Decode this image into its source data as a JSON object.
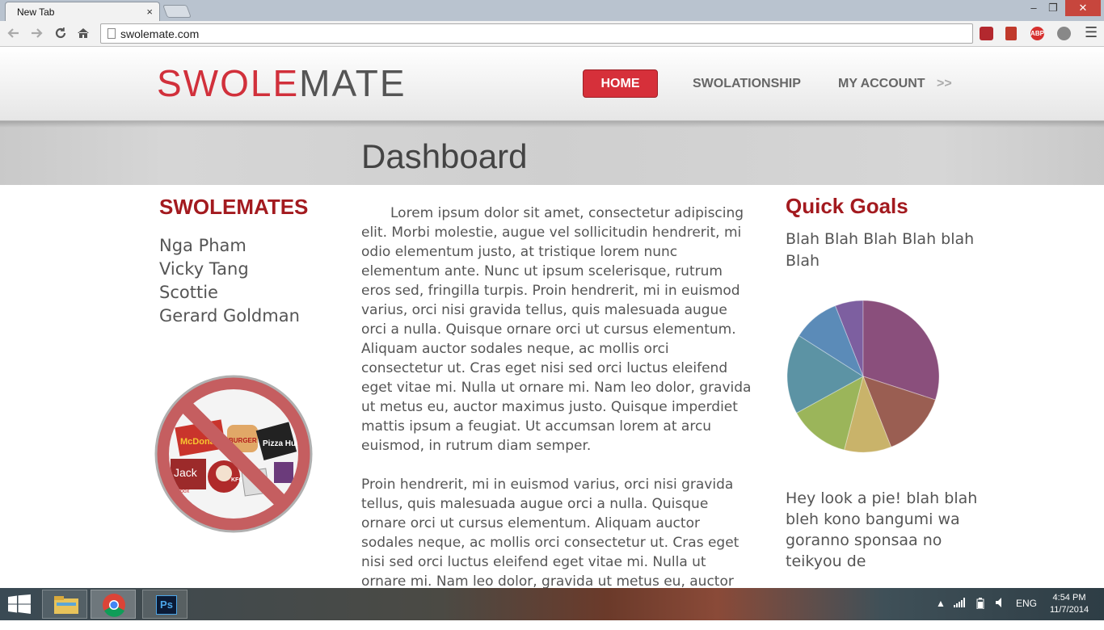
{
  "browser": {
    "tab_title": "New Tab",
    "tab_close": "×",
    "url": "swolemate.com",
    "win_min": "‒",
    "win_max": "❐",
    "win_close": "✕",
    "ext_abp": "ABP"
  },
  "site": {
    "logo_swole": "SWOLE",
    "logo_mate": "MATE",
    "nav": {
      "home": "HOME",
      "swolationship": "SWOLATIONSHIP",
      "my_account": "MY ACCOUNT",
      "my_account_arrow": ">>"
    },
    "page_title": "Dashboard"
  },
  "left": {
    "heading": "SWOLEMATES",
    "mates": [
      "Nga Pham",
      "Vicky Tang",
      "Scottie",
      "Gerard Goldman"
    ],
    "nofood_labels": [
      "McDonald's",
      "BURGER KING",
      "Pizza Hut",
      "Jack",
      "KFC",
      "box"
    ]
  },
  "main": {
    "paragraphs": [
      "Lorem ipsum dolor sit amet, consectetur adipiscing elit. Morbi molestie, augue vel sollicitudin hendrerit, mi odio elementum justo, at tristique lorem nunc elementum ante. Nunc ut ipsum scelerisque, rutrum eros sed, fringilla turpis. Proin hendrerit, mi in euismod varius, orci nisi gravida tellus, quis malesuada augue orci a nulla. Quisque ornare orci ut cursus elementum. Aliquam auctor sodales neque, ac mollis orci consectetur ut. Cras eget nisi sed orci luctus eleifend eget vitae mi. Nulla ut ornare mi. Nam leo dolor, gravida ut metus eu, auctor maximus justo. Quisque imperdiet mattis ipsum a feugiat. Ut accumsan lorem at arcu euismod, in rutrum diam semper.",
      "Proin hendrerit, mi in euismod varius, orci nisi gravida tellus, quis malesuada augue orci a nulla. Quisque ornare orci ut cursus elementum. Aliquam auctor sodales neque, ac mollis orci consectetur ut. Cras eget nisi sed orci luctus eleifend eget vitae mi. Nulla ut ornare mi. Nam leo dolor, gravida ut metus eu, auctor maximus"
    ]
  },
  "right": {
    "heading": "Quick Goals",
    "goals_text": "Blah Blah Blah Blah blah Blah",
    "pie_note": "Hey look a pie! blah blah bleh kono bangumi wa goranno sponsaa no teikyou de",
    "pie_slices": [
      {
        "fraction": 0.06,
        "color": "#7d5fa0"
      },
      {
        "fraction": 0.3,
        "color": "#8a4f7c"
      },
      {
        "fraction": 0.14,
        "color": "#9a5e52"
      },
      {
        "fraction": 0.1,
        "color": "#c9b36a"
      },
      {
        "fraction": 0.13,
        "color": "#9bb55a"
      },
      {
        "fraction": 0.17,
        "color": "#5c93a4"
      },
      {
        "fraction": 0.1,
        "color": "#5b8bb8"
      }
    ]
  },
  "taskbar": {
    "lang": "ENG",
    "time": "4:54 PM",
    "date": "11/7/2014",
    "apps": [
      "file-explorer",
      "chrome",
      "photoshop"
    ],
    "ps_label": "Ps"
  }
}
